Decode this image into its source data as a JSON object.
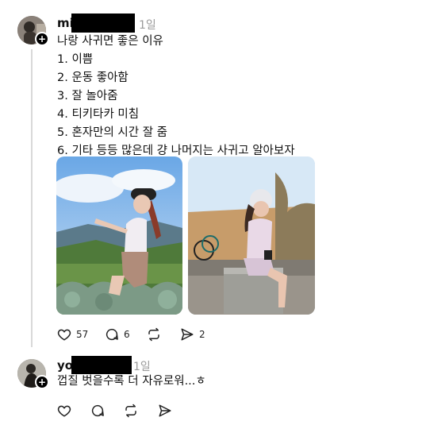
{
  "post1": {
    "username_prefix": "mi",
    "time": "1일",
    "lines": [
      "나랑 사귀면 좋은 이유",
      "1. 이쁨",
      "2. 운동 좋아함",
      "3. 잘 놀아줌",
      "4. 티키타카 미침",
      "5. 혼자만의 시간 잘 줌",
      "6. 기타 등등 많은데 걍 나머지는 사귀고 알아보자"
    ],
    "actions": {
      "like_count": "57",
      "comment_count": "6",
      "share_count": "2"
    }
  },
  "post2": {
    "username_prefix": "yo",
    "time": "1일",
    "text": "껍질 벗을수록 더 자유로워...ㅎ"
  },
  "icons": [
    "heart-icon",
    "comment-icon",
    "repost-icon",
    "send-icon",
    "plus-icon"
  ],
  "colors": {
    "thread_line": "#d9d9d9",
    "time": "#9a9a9a",
    "redaction": "#000000"
  }
}
